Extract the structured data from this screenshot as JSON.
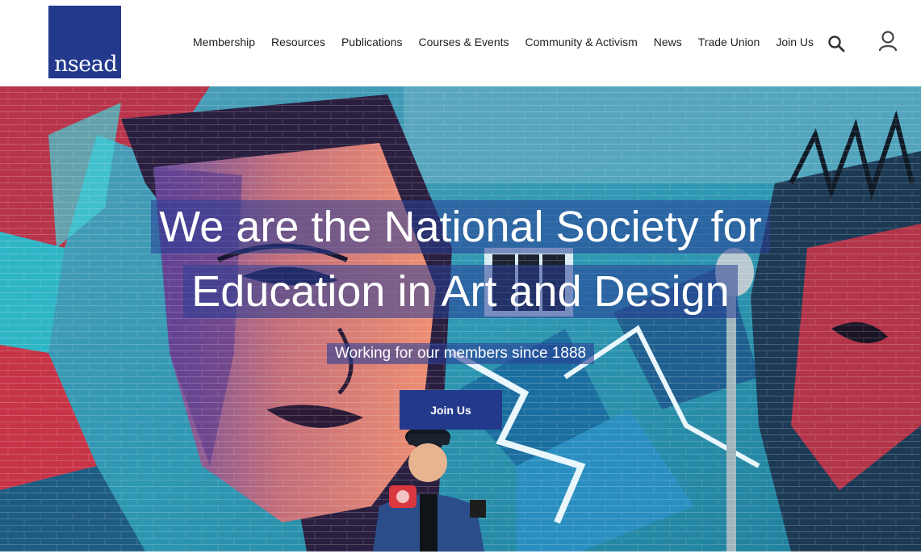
{
  "header": {
    "logo_text": "nsead",
    "nav_items": [
      "Membership",
      "Resources",
      "Publications",
      "Courses & Events",
      "Community & Activism",
      "News",
      "Trade Union",
      "Join Us"
    ],
    "icons": {
      "search": "search-icon",
      "account": "user-icon"
    }
  },
  "hero": {
    "headline_line1": "We are the National Society for",
    "headline_line2": "Education in Art and Design",
    "tagline": "Working for our members since 1888",
    "cta_label": "Join Us",
    "image": "street-mural-photo"
  },
  "colors": {
    "brand_blue": "#233a8c",
    "nav_text": "#1f1f1f",
    "headline_bg": "#283e96"
  }
}
